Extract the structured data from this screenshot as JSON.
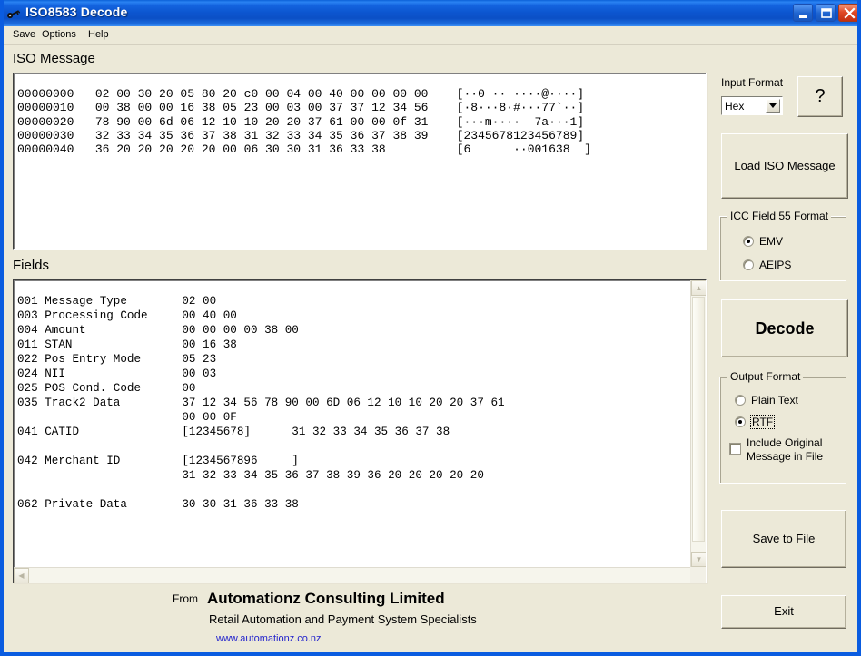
{
  "window": {
    "title": "ISO8583 Decode",
    "icon": "key-icon",
    "controls": {
      "minimize": "minimize-icon",
      "maximize": "maximize-icon",
      "close": "close-icon"
    }
  },
  "menu": {
    "items": [
      {
        "label": "Save"
      },
      {
        "label": "Options"
      },
      {
        "label": "Help"
      }
    ]
  },
  "iso_message": {
    "label": "ISO Message",
    "hex_dump": "00000000   02 00 30 20 05 80 20 c0 00 04 00 40 00 00 00 00    [··0 ·· ····@····]\n00000010   00 38 00 00 16 38 05 23 00 03 00 37 37 12 34 56    [·8···8·#···77`··]\n00000020   78 90 00 6d 06 12 10 10 20 20 37 61 00 00 0f 31    [···m····  7a···1]\n00000030   32 33 34 35 36 37 38 31 32 33 34 35 36 37 38 39    [2345678123456789]\n00000040   36 20 20 20 20 20 00 06 30 30 31 36 33 38          [6      ··001638  ]"
  },
  "fields": {
    "label": "Fields",
    "text": "001 Message Type        02 00\n003 Processing Code     00 40 00\n004 Amount              00 00 00 00 38 00\n011 STAN                00 16 38\n022 Pos Entry Mode      05 23\n024 NII                 00 03\n025 POS Cond. Code      00\n035 Track2 Data         37 12 34 56 78 90 00 6D 06 12 10 10 20 20 37 61\n                        00 00 0F\n041 CATID               [12345678]      31 32 33 34 35 36 37 38\n\n042 Merchant ID         [1234567896     ]\n                        31 32 33 34 35 36 37 38 39 36 20 20 20 20 20\n\n062 Private Data        30 30 31 36 33 38"
  },
  "controls": {
    "input_format_label": "Input Format",
    "input_format_value": "Hex",
    "input_format_options": [
      "Hex"
    ],
    "help_button": "?",
    "load_button": "Load ISO Message",
    "decode_button": "Decode",
    "save_to_file_button": "Save to File",
    "exit_button": "Exit",
    "icc_group": {
      "title": "ICC Field 55 Format",
      "options": [
        {
          "label": "EMV",
          "checked": true
        },
        {
          "label": "AEIPS",
          "checked": false
        }
      ]
    },
    "output_group": {
      "title": "Output Format",
      "options": [
        {
          "label": "Plain Text",
          "checked": false
        },
        {
          "label": "RTF",
          "checked": true,
          "focused": true
        }
      ],
      "include_original": {
        "label": "Include Original Message in File",
        "checked": false
      }
    }
  },
  "footer": {
    "from": "From",
    "company": "Automationz Consulting Limited",
    "tagline": "Retail Automation and Payment System Specialists",
    "url": "www.automationz.co.nz"
  },
  "colors": {
    "window_face": "#ece9d8",
    "title_blue": "#0c55cf",
    "link_blue": "#2222cc",
    "text_area": "#ffffff"
  }
}
